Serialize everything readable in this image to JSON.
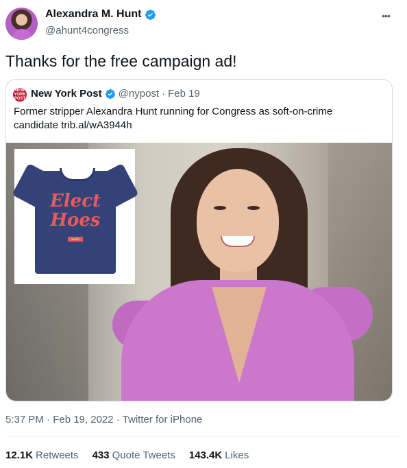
{
  "author": {
    "display_name": "Alexandra M. Hunt",
    "handle": "@ahunt4congress",
    "verified_icon": "verified-badge-icon"
  },
  "tweet": {
    "text": "Thanks for the free campaign ad!"
  },
  "quote": {
    "display_name": "New York Post",
    "handle": "@nypost",
    "separator": "·",
    "date": "Feb 19",
    "logo_text": "NEW YORK POST",
    "text": "Former stripper Alexandra Hunt running for Congress as soft-on-crime candidate trib.al/wA3944h",
    "shirt_text": "Elect Hoes",
    "shirt_tag": "HUNT"
  },
  "meta": {
    "timestamp": "5:37 PM · Feb 19, 2022 · Twitter for iPhone"
  },
  "stats": {
    "retweets_count": "12.1K",
    "retweets_label": "Retweets",
    "quotes_count": "433",
    "quotes_label": "Quote Tweets",
    "likes_count": "143.4K",
    "likes_label": "Likes"
  },
  "colors": {
    "verified": "#1d9bf0",
    "secondary_text": "#536471",
    "nypost_red": "#c8102e"
  }
}
